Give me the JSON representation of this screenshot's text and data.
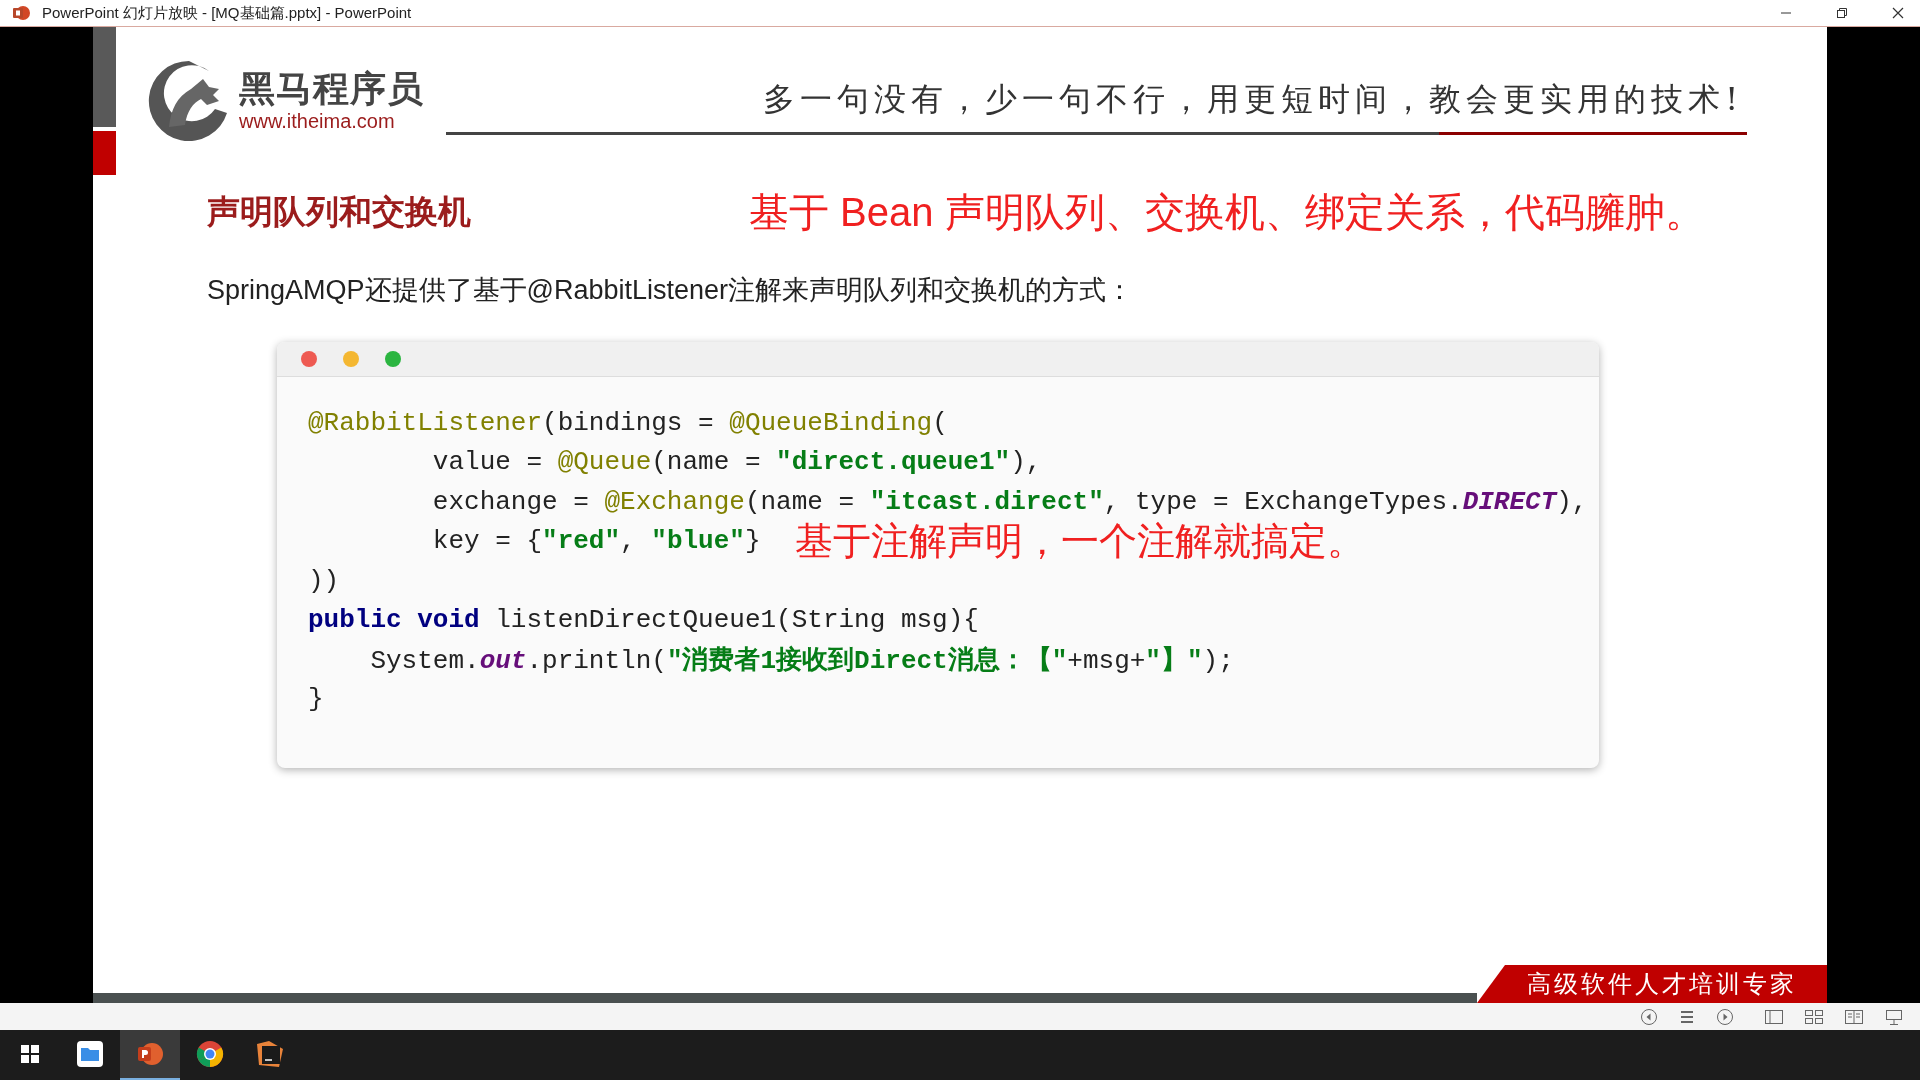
{
  "window": {
    "title": "PowerPoint 幻灯片放映 - [MQ基础篇.pptx] - PowerPoint"
  },
  "slide": {
    "brand": {
      "name": "黑马程序员",
      "url": "www.itheima.com"
    },
    "slogan": "多一句没有，少一句不行，用更短时间，教会更实用的技术!",
    "heading": "声明队列和交换机",
    "heading_note": "基于 Bean 声明队列、交换机、绑定关系，代码臃肿。",
    "intro": "SpringAMQP还提供了基于@RabbitListener注解来声明队列和交换机的方式：",
    "code": {
      "lines": [
        {
          "tokens": [
            {
              "kind": "annotation",
              "text": "@RabbitListener"
            },
            {
              "kind": "plain",
              "text": "(bindings = "
            },
            {
              "kind": "annotation",
              "text": "@QueueBinding"
            },
            {
              "kind": "plain",
              "text": "("
            }
          ]
        },
        {
          "tokens": [
            {
              "kind": "plain",
              "text": "        value = "
            },
            {
              "kind": "annotation",
              "text": "@Queue"
            },
            {
              "kind": "plain",
              "text": "(name = "
            },
            {
              "kind": "string",
              "text": "\"direct.queue1\""
            },
            {
              "kind": "plain",
              "text": "),"
            }
          ]
        },
        {
          "tokens": [
            {
              "kind": "plain",
              "text": "        exchange = "
            },
            {
              "kind": "annotation",
              "text": "@Exchange"
            },
            {
              "kind": "plain",
              "text": "(name = "
            },
            {
              "kind": "string",
              "text": "\"itcast.direct\""
            },
            {
              "kind": "plain",
              "text": ", type = ExchangeTypes."
            },
            {
              "kind": "constant",
              "text": "DIRECT"
            },
            {
              "kind": "plain",
              "text": "),"
            }
          ]
        },
        {
          "tokens": [
            {
              "kind": "plain",
              "text": "        key = {"
            },
            {
              "kind": "string",
              "text": "\"red\""
            },
            {
              "kind": "plain",
              "text": ", "
            },
            {
              "kind": "string",
              "text": "\"blue\""
            },
            {
              "kind": "plain",
              "text": "}"
            }
          ],
          "note": "基于注解声明，一个注解就搞定。"
        },
        {
          "tokens": [
            {
              "kind": "plain",
              "text": "))"
            }
          ]
        },
        {
          "tokens": [
            {
              "kind": "keyword",
              "text": "public void"
            },
            {
              "kind": "plain",
              "text": " listenDirectQueue1(String msg){"
            }
          ]
        },
        {
          "tokens": [
            {
              "kind": "plain",
              "text": "    System."
            },
            {
              "kind": "constant",
              "text": "out"
            },
            {
              "kind": "plain",
              "text": ".println("
            },
            {
              "kind": "string",
              "text": "\"消费者1接收到Direct消息：【\""
            },
            {
              "kind": "plain",
              "text": "+msg+"
            },
            {
              "kind": "string",
              "text": "\"】\""
            },
            {
              "kind": "plain",
              "text": ");"
            }
          ]
        },
        {
          "tokens": [
            {
              "kind": "plain",
              "text": "}"
            }
          ]
        }
      ]
    },
    "banner": "高级软件人才培训专家"
  },
  "taskbar": [
    {
      "kind": "start",
      "selected": false
    },
    {
      "kind": "files",
      "selected": false
    },
    {
      "kind": "powerpoint",
      "selected": true
    },
    {
      "kind": "chrome",
      "selected": false
    },
    {
      "kind": "ide",
      "selected": false
    }
  ]
}
